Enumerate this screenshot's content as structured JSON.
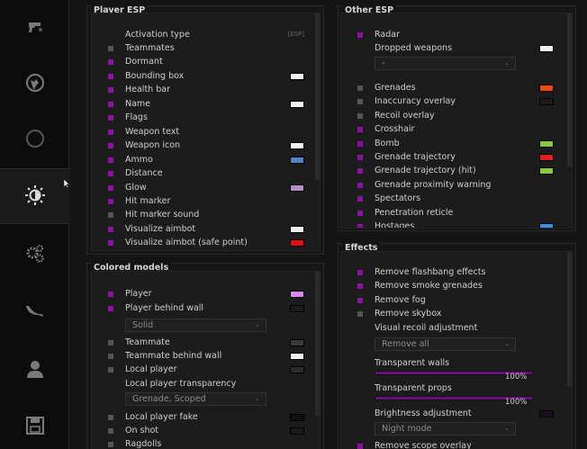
{
  "sidebar": {
    "tabs": [
      {
        "name": "tab-aimbot",
        "icon": "pistol-icon"
      },
      {
        "name": "tab-legit",
        "icon": "globe-skull-icon"
      },
      {
        "name": "tab-misc-circle",
        "icon": "circle-icon"
      },
      {
        "name": "tab-visuals",
        "icon": "brightness-icon",
        "active": true
      },
      {
        "name": "tab-settings",
        "icon": "gears-icon"
      },
      {
        "name": "tab-skins",
        "icon": "knife-icon"
      },
      {
        "name": "tab-players",
        "icon": "person-icon"
      },
      {
        "name": "tab-config",
        "icon": "save-icon"
      }
    ]
  },
  "player_esp": {
    "title": "Player ESP",
    "activation_label": "Activation type",
    "activation_value": "[ESP]",
    "items": [
      {
        "label": "Teammates",
        "checked": false,
        "color": null
      },
      {
        "label": "Dormant",
        "checked": true,
        "color": null
      },
      {
        "label": "Bounding box",
        "checked": true,
        "color": "#f0f0f0"
      },
      {
        "label": "Health bar",
        "checked": true,
        "color": null
      },
      {
        "label": "Name",
        "checked": true,
        "color": "#f0f0f0"
      },
      {
        "label": "Flags",
        "checked": true,
        "color": null
      },
      {
        "label": "Weapon text",
        "checked": true,
        "color": null
      },
      {
        "label": "Weapon icon",
        "checked": true,
        "color": "#f0f0f0"
      },
      {
        "label": "Ammo",
        "checked": true,
        "color": "#4f86c6"
      },
      {
        "label": "Distance",
        "checked": true,
        "color": null
      },
      {
        "label": "Glow",
        "checked": true,
        "color": "#b58cc4"
      },
      {
        "label": "Hit marker",
        "checked": true,
        "color": null
      },
      {
        "label": "Hit marker sound",
        "checked": false,
        "color": null
      },
      {
        "label": "Visualize aimbot",
        "checked": true,
        "color": "#f0f0f0"
      },
      {
        "label": "Visualize aimbot (safe point)",
        "checked": true,
        "color": "#e01010"
      }
    ]
  },
  "colored_models": {
    "title": "Colored models",
    "player_label": "Player",
    "player_color": "#d58ce8",
    "behind_wall_label": "Player behind wall",
    "behind_wall_color": "#1c1c1c",
    "material_value": "Solid",
    "teammate_label": "Teammate",
    "teammate_color": "#3a3a3a",
    "teammate_wall_label": "Teammate behind wall",
    "teammate_wall_color": "#f0f0f0",
    "local_player_label": "Local player",
    "local_player_color": "#2c2c2c",
    "transparency_label": "Local player transparency",
    "transparency_value": "Grenade, Scoped",
    "fake_label": "Local player fake",
    "fake_color": "#111111",
    "on_shot_label": "On shot",
    "on_shot_color": "#1a1a1a",
    "ragdolls_label": "Ragdolls"
  },
  "other_esp": {
    "title": "Other ESP",
    "radar_label": "Radar",
    "dropped_label": "Dropped weapons",
    "dropped_color": "#f0f0f0",
    "dropped_dd": "-",
    "items": [
      {
        "label": "Grenades",
        "checked": false,
        "color": "#ee4a10"
      },
      {
        "label": "Inaccuracy overlay",
        "checked": false,
        "color": "#1a1a1a"
      },
      {
        "label": "Recoil overlay",
        "checked": false,
        "color": null
      },
      {
        "label": "Crosshair",
        "checked": true,
        "color": null
      },
      {
        "label": "Bomb",
        "checked": true,
        "color": "#8dc63f"
      },
      {
        "label": "Grenade trajectory",
        "checked": true,
        "color": "#e02020"
      },
      {
        "label": "Grenade trajectory (hit)",
        "checked": true,
        "color": "#8dc63f"
      },
      {
        "label": "Grenade proximity warning",
        "checked": true,
        "color": null
      },
      {
        "label": "Spectators",
        "checked": true,
        "color": null
      },
      {
        "label": "Penetration reticle",
        "checked": true,
        "color": null
      },
      {
        "label": "Hostages",
        "checked": true,
        "color": "#3a8ee8"
      }
    ]
  },
  "effects": {
    "title": "Effects",
    "items": [
      {
        "label": "Remove flashbang effects",
        "checked": true
      },
      {
        "label": "Remove smoke grenades",
        "checked": true
      },
      {
        "label": "Remove fog",
        "checked": true
      },
      {
        "label": "Remove skybox",
        "checked": false
      }
    ],
    "recoil_label": "Visual recoil adjustment",
    "recoil_value": "Remove all",
    "walls_label": "Transparent walls",
    "walls_value": "100%",
    "walls_fraction": 1.0,
    "props_label": "Transparent props",
    "props_value": "100%",
    "props_fraction": 1.0,
    "brightness_label": "Brightness adjustment",
    "brightness_color": "#1a0f22",
    "brightness_value": "Night mode",
    "scope_label": "Remove scope overlay"
  }
}
